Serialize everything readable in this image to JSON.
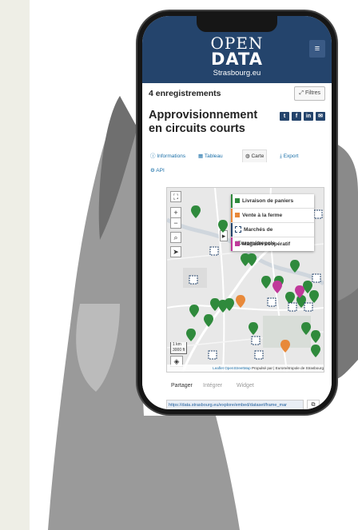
{
  "header": {
    "logo_line1": "OPEN",
    "logo_line2": "DATA",
    "logo_line3": "Strasbourg.eu",
    "menu_icon": "hamburger-icon"
  },
  "toolbar": {
    "records": "4 enregistrements",
    "filters": "Filtres"
  },
  "dataset": {
    "title": "Approvisionnement en circuits courts",
    "social": [
      "twitter-icon",
      "facebook-icon",
      "linkedin-icon",
      "mail-icon"
    ]
  },
  "tabs": {
    "informations": "Informations",
    "tableau": "Tableau",
    "carte": "Carte",
    "export": "Export",
    "api": "API"
  },
  "map": {
    "legend": [
      {
        "label": "Livraison de paniers",
        "color": "#2f8a3c"
      },
      {
        "label": "Vente à la ferme",
        "color": "#e8893a"
      },
      {
        "label": "Marchés de l'Eurométropole",
        "color": "#24446c"
      },
      {
        "label": "Magasin coopératif",
        "color": "#c0399a"
      }
    ],
    "scale_km": "1 km",
    "scale_ft": "3000 ft",
    "attribution_leaflet": "Leaflet",
    "attribution_osm": "OpenStreetMap",
    "attribution_rest": "Propulsé par | Eurométropole de Strasbourg"
  },
  "share": {
    "tabs": [
      "Partager",
      "Intégrer",
      "Widget"
    ],
    "url": "https://data.strasbourg.eu/explore/embed/dataset/frame_mar"
  }
}
